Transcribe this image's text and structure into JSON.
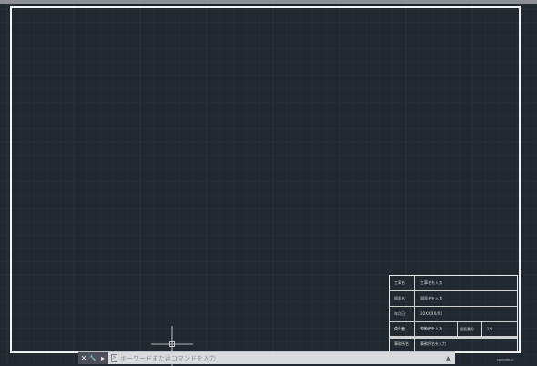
{
  "colors": {
    "background": "#212830",
    "frame": "#f2f2f2",
    "grid_minor": "#283039",
    "grid_major": "#303a45",
    "cmdbar": "#d9dadb",
    "crosshair": "#e6e6e6"
  },
  "title_block": {
    "rows": [
      {
        "label": "工事名",
        "value": "工事名を入力"
      },
      {
        "label": "図面名",
        "value": "図面名を入力"
      },
      {
        "label": "年月日",
        "value": "20XX/XX/XX"
      },
      {
        "label": "尺　度",
        "value": "1/XX",
        "label2": "図面番号",
        "value2": "1/1"
      },
      {
        "label": "会社名",
        "value": "会社名を入力"
      },
      {
        "label": "事務所名",
        "value": "事務所名を入力"
      }
    ],
    "watermark": "cadnote.jp"
  },
  "command_bar": {
    "placeholder": "キーワードまたはコマンドを入力",
    "tools": [
      {
        "icon": "close-icon",
        "glyph": "✕"
      },
      {
        "icon": "wrench-icon",
        "glyph": "🔧"
      },
      {
        "icon": "history-icon",
        "glyph": "▸"
      }
    ],
    "prompt_glyph": ">",
    "dropdown_glyph": "▲"
  }
}
